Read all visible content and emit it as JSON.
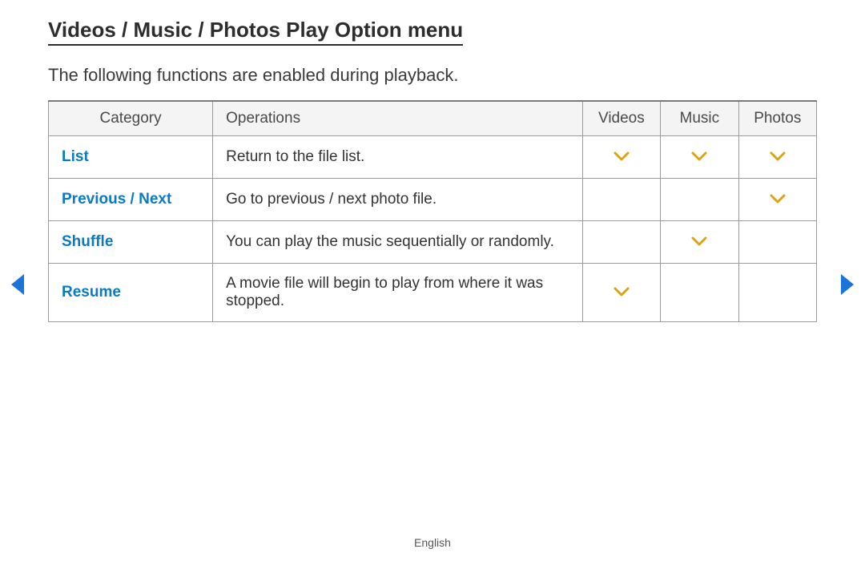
{
  "title": "Videos / Music / Photos Play Option menu",
  "intro": "The following functions are enabled during playback.",
  "table": {
    "headers": {
      "category": "Category",
      "operations": "Operations",
      "videos": "Videos",
      "music": "Music",
      "photos": "Photos"
    },
    "rows": [
      {
        "category": "List",
        "operations": "Return to the file list.",
        "videos": true,
        "music": true,
        "photos": true
      },
      {
        "category": "Previous / Next",
        "operations": "Go to previous / next photo file.",
        "videos": false,
        "music": false,
        "photos": true
      },
      {
        "category": "Shuffle",
        "operations": "You can play the music sequentially or randomly.",
        "videos": false,
        "music": true,
        "photos": false
      },
      {
        "category": "Resume",
        "operations": "A movie file will begin to play from where it was stopped.",
        "videos": true,
        "music": false,
        "photos": false
      }
    ]
  },
  "checkGlyph": "∨",
  "footer": {
    "language": "English"
  },
  "colors": {
    "linkBlue": "#0a7ac2",
    "checkGold": "#d9a514",
    "navBlue": "#1b74d8"
  }
}
